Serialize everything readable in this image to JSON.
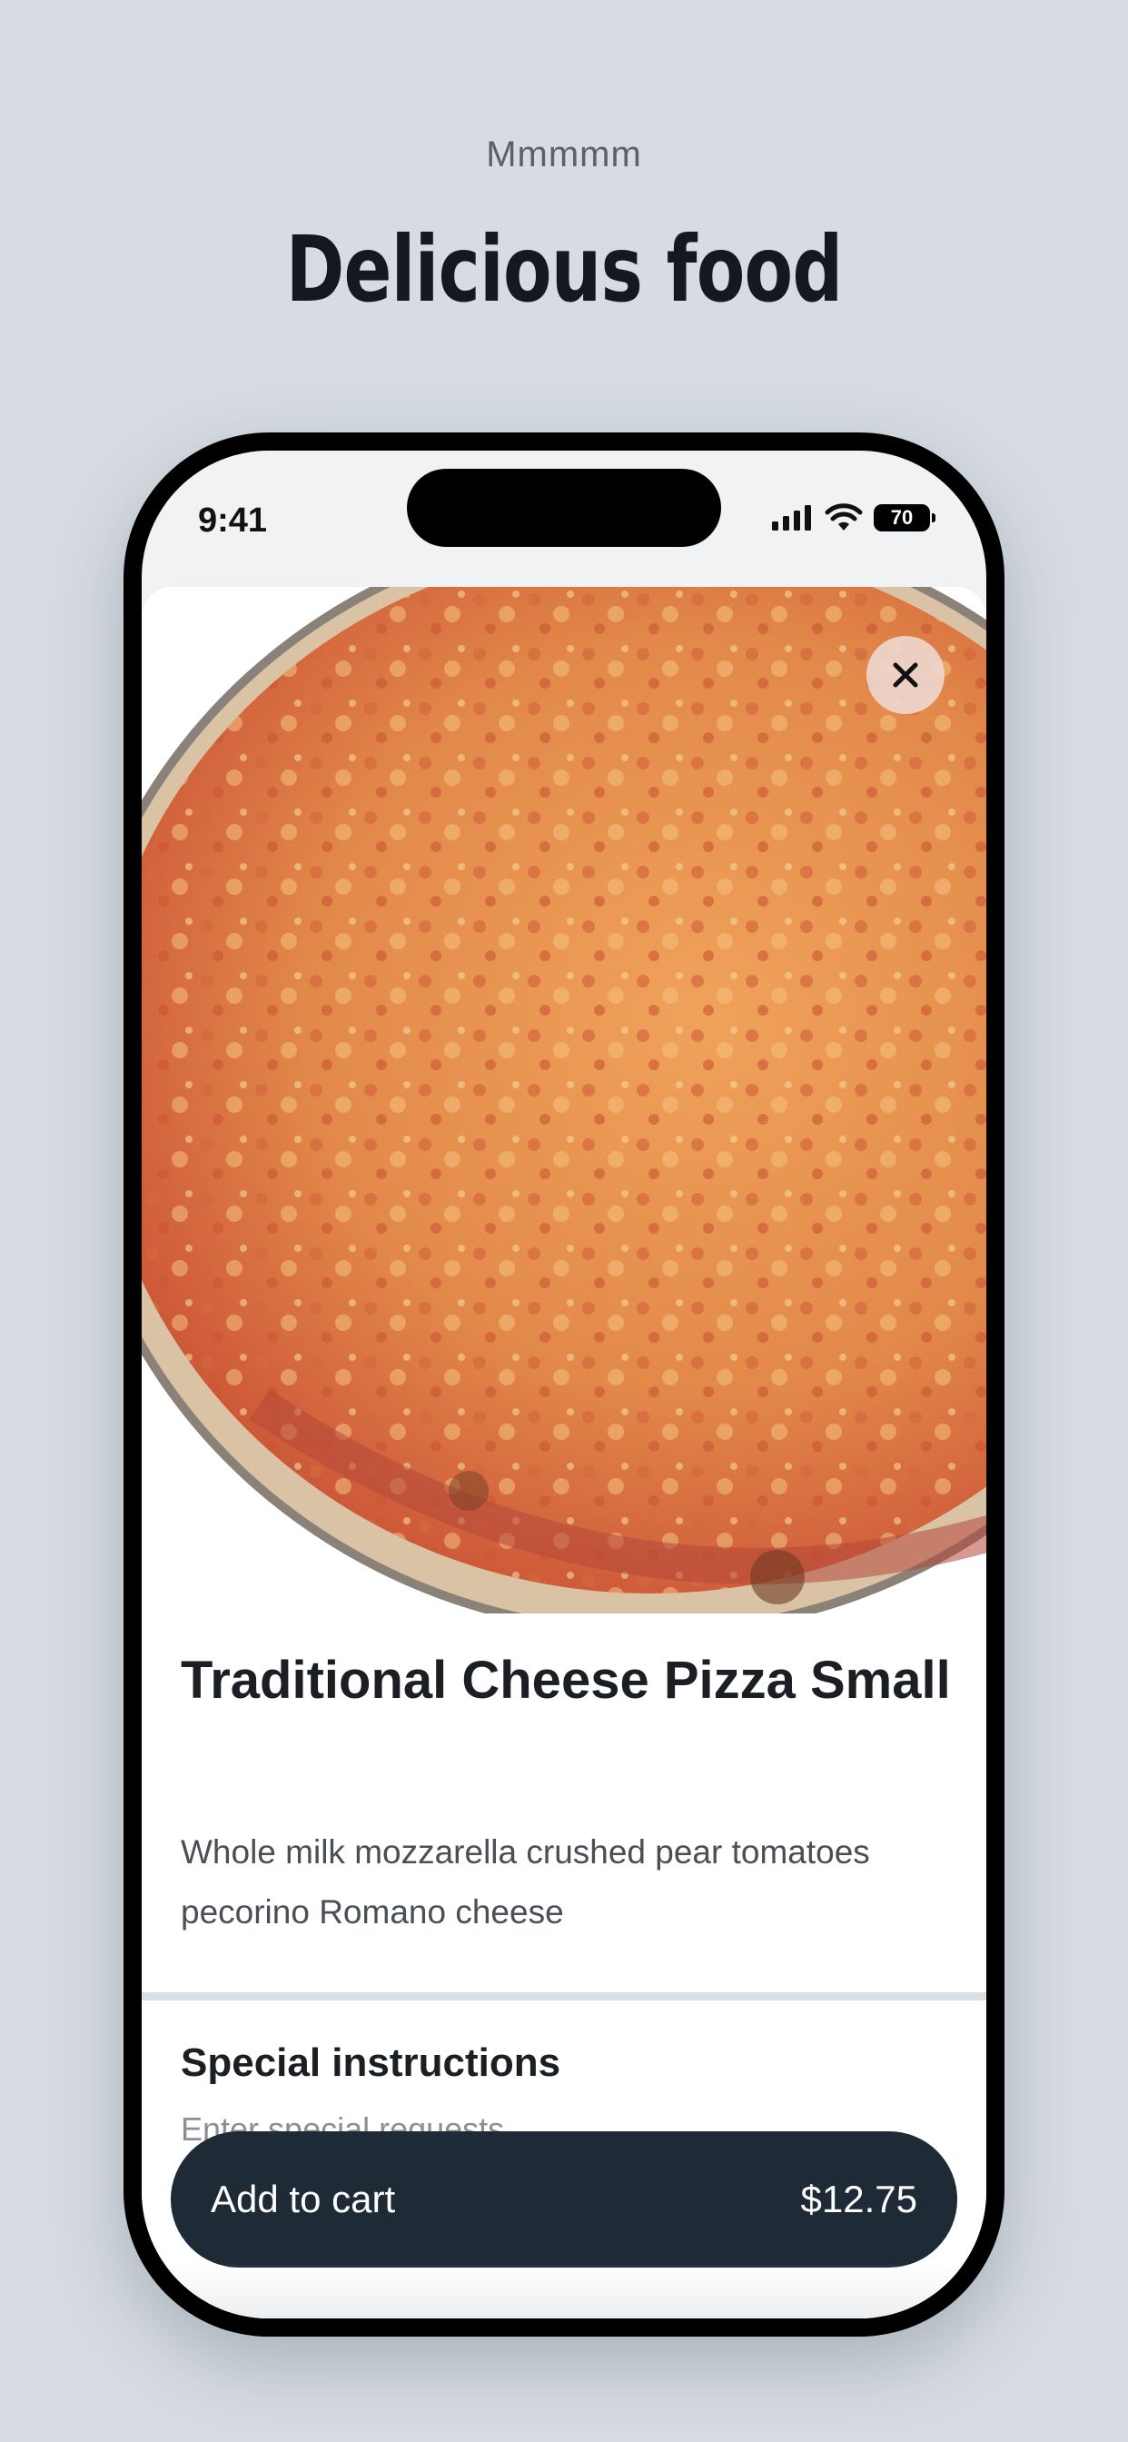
{
  "promo": {
    "eyebrow": "Mmmmm",
    "headline": "Delicious food"
  },
  "status_bar": {
    "time": "9:41",
    "battery": "70",
    "icons": [
      "signal-icon",
      "wifi-icon",
      "battery-icon"
    ]
  },
  "product": {
    "image": "pizza-photo",
    "close_icon": "close-icon",
    "title": "Traditional Cheese Pizza Small",
    "description": "Whole milk mozzarella crushed pear tomatoes pecorino Romano cheese"
  },
  "instructions": {
    "title": "Special instructions",
    "placeholder": "Enter special requests"
  },
  "cart": {
    "label": "Add to cart",
    "price": "$12.75"
  },
  "colors": {
    "background": "#d6dce2",
    "button": "#1e2b36",
    "close_button": "#eed6cd"
  }
}
